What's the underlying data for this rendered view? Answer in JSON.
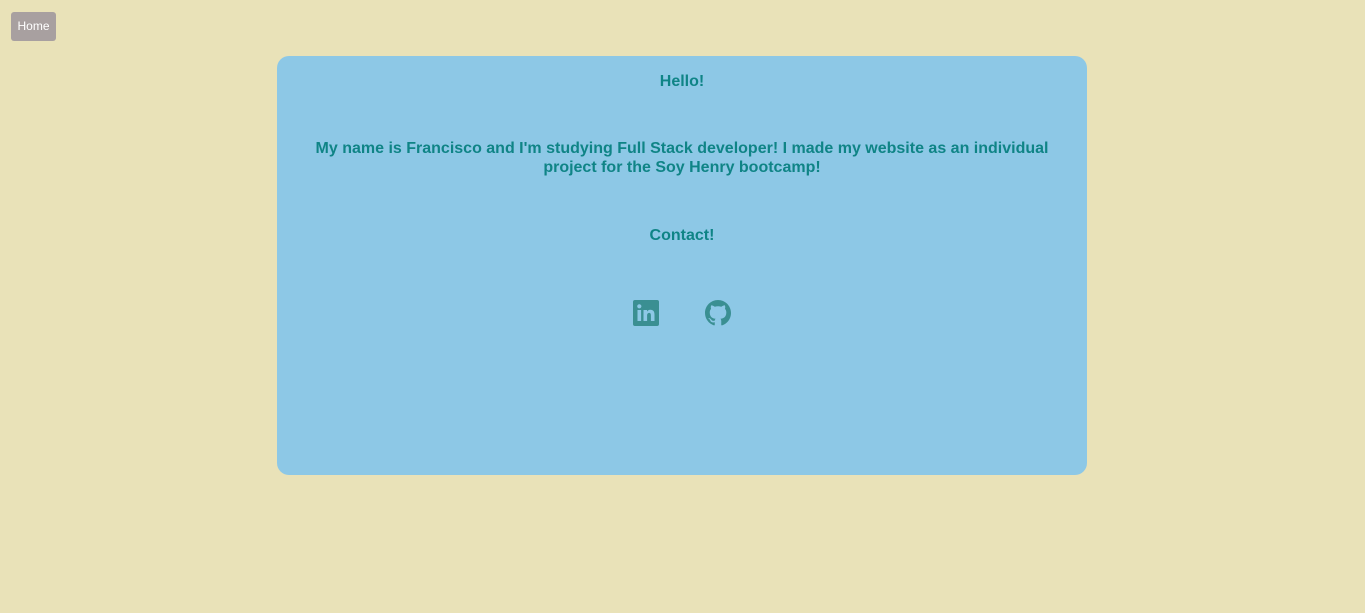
{
  "nav": {
    "home_label": "Home"
  },
  "card": {
    "greeting": "Hello!",
    "intro": "My name is Francisco and I'm studying Full Stack developer! I made my website as an individual project for the Soy Henry bootcamp!",
    "contact_heading": "Contact!",
    "links": [
      {
        "icon": "linkedin-icon"
      },
      {
        "icon": "github-icon"
      }
    ]
  },
  "colors": {
    "page_background": "#e9e2b8",
    "card_background": "#8dc8e6",
    "text": "#0f8486",
    "icon": "#3a8f92",
    "home_button": "#a8a0a0"
  }
}
